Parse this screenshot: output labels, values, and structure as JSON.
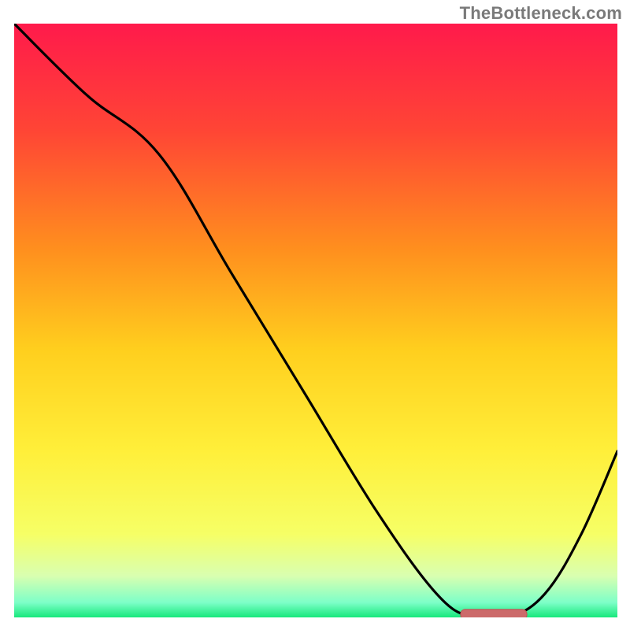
{
  "attribution": "TheBottleneck.com",
  "chart_data": {
    "type": "line",
    "title": "",
    "xlabel": "",
    "ylabel": "",
    "xlim": [
      0,
      100
    ],
    "ylim": [
      0,
      100
    ],
    "series": [
      {
        "name": "curve",
        "x": [
          0,
          12,
          24,
          36,
          48,
          60,
          70,
          76,
          82,
          88,
          94,
          100
        ],
        "values": [
          100,
          88,
          78,
          58,
          38,
          18,
          4,
          0,
          0,
          4,
          14,
          28
        ]
      }
    ],
    "marker": {
      "x_start": 74,
      "x_end": 85,
      "y": 0.5
    },
    "gradient_stops": [
      {
        "offset": 0.0,
        "color": "#ff1a4b"
      },
      {
        "offset": 0.18,
        "color": "#ff4535"
      },
      {
        "offset": 0.38,
        "color": "#ff8f1e"
      },
      {
        "offset": 0.55,
        "color": "#ffcf1e"
      },
      {
        "offset": 0.72,
        "color": "#ffef3a"
      },
      {
        "offset": 0.86,
        "color": "#f6ff66"
      },
      {
        "offset": 0.93,
        "color": "#d9ffb0"
      },
      {
        "offset": 0.975,
        "color": "#7dffc8"
      },
      {
        "offset": 1.0,
        "color": "#17e87c"
      }
    ],
    "colors": {
      "curve": "#000000",
      "marker_fill": "#cc6a6a",
      "marker_stroke": "#b95656",
      "frame": "#000000"
    }
  }
}
